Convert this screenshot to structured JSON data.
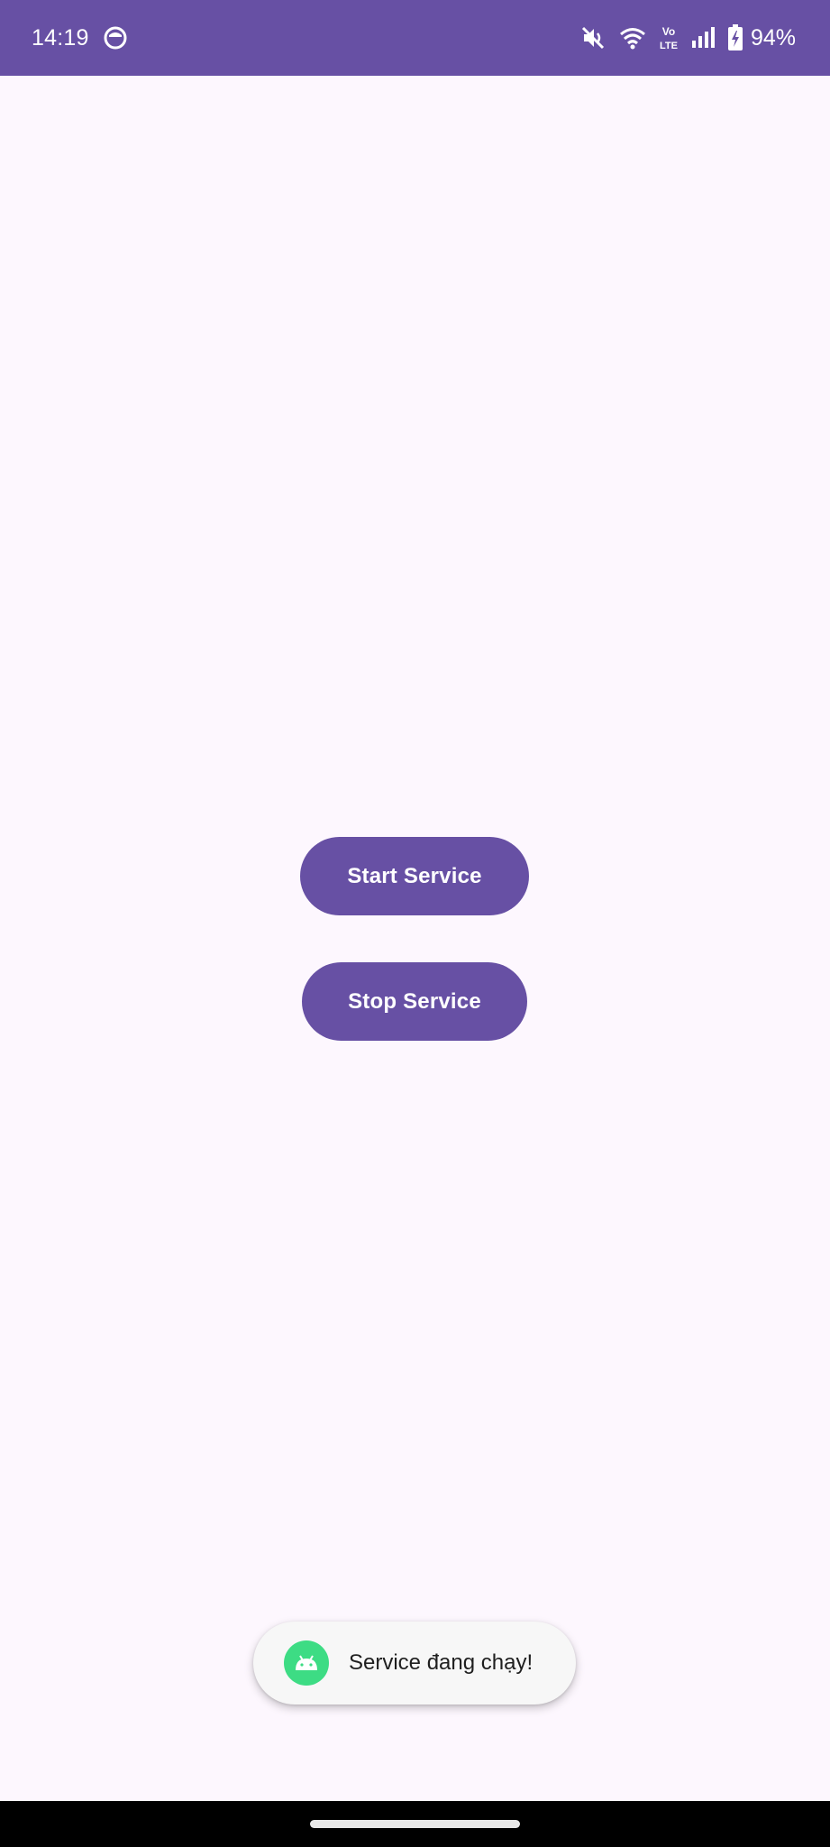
{
  "status_bar": {
    "time": "14:19",
    "battery": "94%",
    "network_label": "Vo LTE",
    "icons": [
      "app-notification-icon",
      "mute-icon",
      "wifi-icon",
      "volte-icon",
      "signal-icon",
      "battery-charging-icon"
    ]
  },
  "main": {
    "start_button_label": "Start Service",
    "stop_button_label": "Stop Service"
  },
  "toast": {
    "icon": "android-icon",
    "message": "Service đang chạy!"
  },
  "colors": {
    "primary": "#6750A4",
    "background": "#FDF7FE",
    "toast_background": "#F7F7F7",
    "android_green": "#3DDC84",
    "nav_bar": "#000000"
  }
}
